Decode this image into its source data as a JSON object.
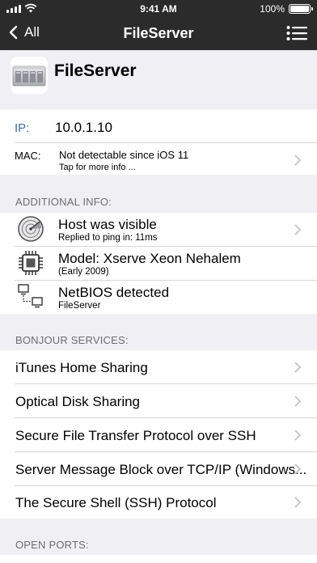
{
  "status_bar": {
    "time": "9:41 AM",
    "battery_pct": "100%",
    "battery_level": 1.0,
    "signal_bars": 4
  },
  "navbar": {
    "back_label": "All",
    "title": "FileServer",
    "back_icon": "chevron-left-icon",
    "menu_icon": "list-menu-icon"
  },
  "device": {
    "name": "FileServer",
    "icon": "server-rack-icon"
  },
  "network": {
    "ip_label": "IP:",
    "ip_value": "10.0.1.10",
    "mac_label": "MAC:",
    "mac_value": "Not detectable since iOS 11",
    "mac_hint": "Tap for more info ..."
  },
  "additional_info": {
    "header": "ADDITIONAL INFO:",
    "items": [
      {
        "title": "Host was visible",
        "subtitle": "Replied to ping in: 11ms",
        "icon": "radar-icon"
      },
      {
        "title": "Model: Xserve Xeon Nehalem",
        "subtitle": "(Early 2009)",
        "icon": "cpu-chip-icon"
      },
      {
        "title": "NetBIOS detected",
        "subtitle": "FileServer",
        "icon": "network-computers-icon"
      }
    ]
  },
  "bonjour": {
    "header": "BONJOUR SERVICES:",
    "items": [
      {
        "label": "iTunes Home Sharing"
      },
      {
        "label": "Optical Disk Sharing"
      },
      {
        "label": "Secure File Transfer Protocol over SSH"
      },
      {
        "label": "Server Message Block over TCP/IP (Windows..."
      },
      {
        "label": "The Secure Shell (SSH) Protocol"
      }
    ]
  },
  "open_ports": {
    "header": "OPEN PORTS:"
  },
  "colors": {
    "bar_bg": "#2b2b2b",
    "page_bg": "#efeff4",
    "ip_label": "#3e6fb3",
    "section_text": "#6d6d72",
    "chevron": "#c7c7cc"
  }
}
